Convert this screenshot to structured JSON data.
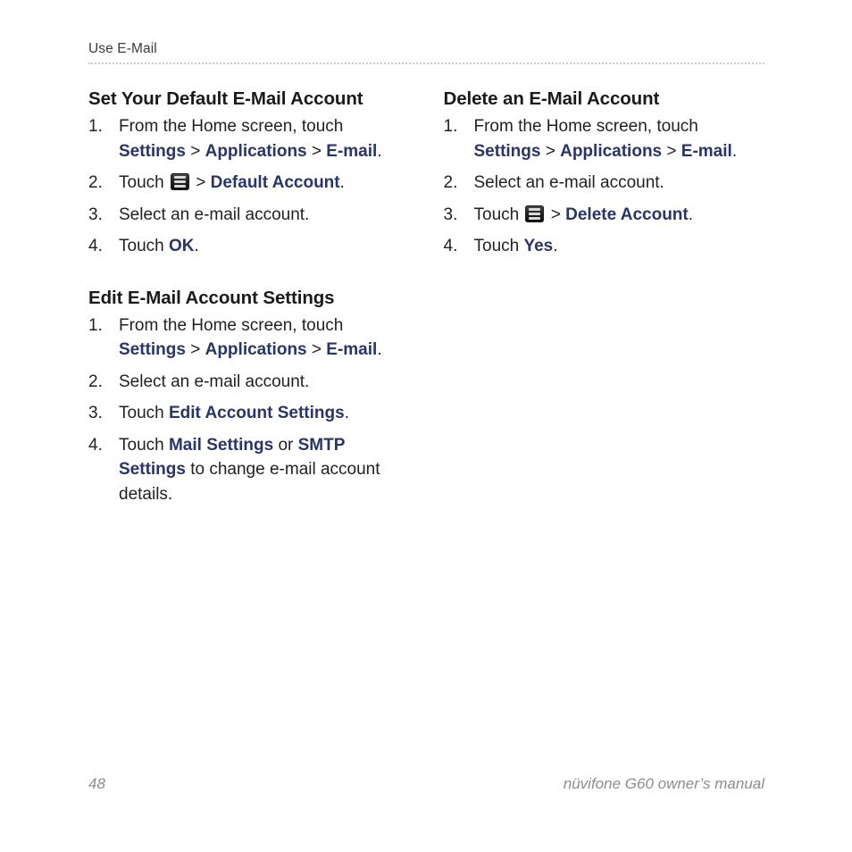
{
  "header": {
    "running_head": "Use E-Mail"
  },
  "colors": {
    "ui_term_blue": "#27356a",
    "body_text": "#231f20",
    "heading": "#1a1a1a",
    "footer_gray": "#8c8c8c",
    "rule_gray": "#c8c8c8"
  },
  "left_column": {
    "sections": [
      {
        "title": "Set Your Default E-Mail Account",
        "steps": [
          {
            "number": "1.",
            "parts": [
              {
                "type": "text",
                "value": "From the Home screen, touch "
              },
              {
                "type": "ui",
                "value": "Settings"
              },
              {
                "type": "sep",
                "value": " > "
              },
              {
                "type": "ui",
                "value": "Applications"
              },
              {
                "type": "sep",
                "value": " > "
              },
              {
                "type": "ui",
                "value": "E-mail"
              },
              {
                "type": "text",
                "value": "."
              }
            ]
          },
          {
            "number": "2.",
            "parts": [
              {
                "type": "text",
                "value": "Touch "
              },
              {
                "type": "icon",
                "value": "menu-icon"
              },
              {
                "type": "sep",
                "value": " > "
              },
              {
                "type": "ui",
                "value": "Default Account"
              },
              {
                "type": "text",
                "value": "."
              }
            ]
          },
          {
            "number": "3.",
            "parts": [
              {
                "type": "text",
                "value": "Select an e-mail account."
              }
            ]
          },
          {
            "number": "4.",
            "parts": [
              {
                "type": "text",
                "value": "Touch "
              },
              {
                "type": "ui",
                "value": "OK"
              },
              {
                "type": "text",
                "value": "."
              }
            ]
          }
        ]
      },
      {
        "title": "Edit E-Mail Account Settings",
        "steps": [
          {
            "number": "1.",
            "parts": [
              {
                "type": "text",
                "value": "From the Home screen, touch "
              },
              {
                "type": "ui",
                "value": "Settings"
              },
              {
                "type": "sep",
                "value": " > "
              },
              {
                "type": "ui",
                "value": "Applications"
              },
              {
                "type": "sep",
                "value": " > "
              },
              {
                "type": "ui",
                "value": "E-mail"
              },
              {
                "type": "text",
                "value": "."
              }
            ]
          },
          {
            "number": "2.",
            "parts": [
              {
                "type": "text",
                "value": "Select an e-mail account."
              }
            ]
          },
          {
            "number": "3.",
            "parts": [
              {
                "type": "text",
                "value": "Touch "
              },
              {
                "type": "ui",
                "value": "Edit Account Settings"
              },
              {
                "type": "text",
                "value": "."
              }
            ]
          },
          {
            "number": "4.",
            "parts": [
              {
                "type": "text",
                "value": "Touch "
              },
              {
                "type": "ui",
                "value": "Mail Settings"
              },
              {
                "type": "text",
                "value": " or "
              },
              {
                "type": "ui",
                "value": "SMTP Settings"
              },
              {
                "type": "text",
                "value": " to change e-mail account details."
              }
            ]
          }
        ]
      }
    ]
  },
  "right_column": {
    "sections": [
      {
        "title": "Delete an E-Mail Account",
        "steps": [
          {
            "number": "1.",
            "parts": [
              {
                "type": "text",
                "value": "From the Home screen, touch "
              },
              {
                "type": "ui",
                "value": "Settings"
              },
              {
                "type": "sep",
                "value": " > "
              },
              {
                "type": "ui",
                "value": "Applications"
              },
              {
                "type": "sep",
                "value": " > "
              },
              {
                "type": "ui",
                "value": "E-mail"
              },
              {
                "type": "text",
                "value": "."
              }
            ]
          },
          {
            "number": "2.",
            "parts": [
              {
                "type": "text",
                "value": "Select an e-mail account."
              }
            ]
          },
          {
            "number": "3.",
            "parts": [
              {
                "type": "text",
                "value": "Touch "
              },
              {
                "type": "icon",
                "value": "menu-icon"
              },
              {
                "type": "sep",
                "value": " > "
              },
              {
                "type": "ui",
                "value": "Delete Account"
              },
              {
                "type": "text",
                "value": "."
              }
            ]
          },
          {
            "number": "4.",
            "parts": [
              {
                "type": "text",
                "value": "Touch "
              },
              {
                "type": "ui",
                "value": "Yes"
              },
              {
                "type": "text",
                "value": "."
              }
            ]
          }
        ]
      }
    ]
  },
  "footer": {
    "page_number": "48",
    "manual_title": "nüvifone G60 owner’s manual"
  }
}
